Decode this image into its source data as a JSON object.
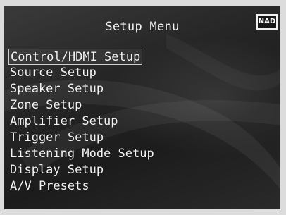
{
  "screen": {
    "title": "Setup Menu",
    "brand_logo": "NAD"
  },
  "menu": {
    "selected_index": 0,
    "items": [
      {
        "label": "Control/HDMI Setup"
      },
      {
        "label": "Source Setup"
      },
      {
        "label": "Speaker Setup"
      },
      {
        "label": "Zone Setup"
      },
      {
        "label": "Amplifier Setup"
      },
      {
        "label": "Trigger Setup"
      },
      {
        "label": "Listening Mode Setup"
      },
      {
        "label": "Display Setup"
      },
      {
        "label": "A/V Presets"
      }
    ]
  }
}
